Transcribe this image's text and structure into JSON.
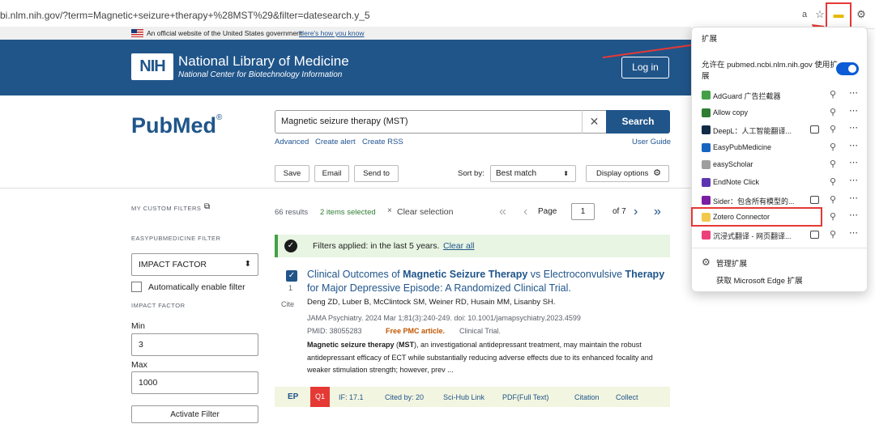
{
  "browser": {
    "url": "bi.nlm.nih.gov/?term=Magnetic+seizure+therapy+%28MST%29&filter=datesearch.y_5"
  },
  "gov_banner": {
    "text": "An official website of the United States government",
    "link": "Here's how you know"
  },
  "header": {
    "nih": "NIH",
    "title": "National Library of Medicine",
    "subtitle": "National Center for Biotechnology Information",
    "login": "Log in"
  },
  "logo": {
    "pub": "Pub",
    "med": "Med",
    "reg": "®"
  },
  "search": {
    "value": "Magnetic seizure therapy (MST)",
    "button": "Search",
    "advanced": "Advanced",
    "create_alert": "Create alert",
    "create_rss": "Create RSS",
    "user_guide": "User Guide"
  },
  "actions": {
    "save": "Save",
    "email": "Email",
    "send_to": "Send to",
    "sort_by": "Sort by:",
    "sort_value": "Best match",
    "display": "Display options"
  },
  "sidebar": {
    "custom_filters": "MY CUSTOM FILTERS",
    "easy_filter": "EASYPUBMEDICINE FILTER",
    "select": "IMPACT FACTOR",
    "auto": "Automatically enable filter",
    "if_label": "IMPACT FACTOR",
    "min_label": "Min",
    "min_value": "3",
    "max_label": "Max",
    "max_value": "1000",
    "activate": "Activate Filter"
  },
  "results": {
    "count": "66 results",
    "selected": "2 items selected",
    "clear": "Clear selection",
    "page_label": "Page",
    "page_value": "1",
    "page_of": "of 7",
    "filter_text": "Filters applied: in the last 5 years.",
    "filter_clear": "Clear all",
    "item": {
      "num": "1",
      "cite": "Cite",
      "title_a": "Clinical Outcomes of ",
      "title_b": "Magnetic Seizure Therapy",
      "title_c": " vs Electroconvulsive ",
      "title_d": "Therapy",
      "title_e": " for Major Depressive Episode: A Randomized Clinical Trial.",
      "authors": "Deng ZD, Luber B, McClintock SM, Weiner RD, Husain MM, Lisanby SH.",
      "journal": "JAMA Psychiatry. 2024 Mar 1;81(3):240-249. doi: 10.1001/jamapsychiatry.2023.4599",
      "pmid": "PMID: 38055283",
      "pmc": "Free PMC article.",
      "type": "Clinical Trial.",
      "snip_b": "Magnetic seizure therapy",
      "snip_mst": "MST",
      "snippet": "), an investigational antidepressant treatment, may maintain the robust antidepressant efficacy of ECT while substantially reducing adverse effects due to its enhanced focality and weaker stimulation strength; however, prev ..."
    },
    "easy_bar": {
      "logo": "EP",
      "q": "Q1",
      "if": "IF:  17.1",
      "cited": "Cited by:  20",
      "scihub": "Sci-Hub Link",
      "pdf": "PDF(Full Text)",
      "citation": "Citation",
      "collect": "Collect"
    }
  },
  "extensions": {
    "title": "扩展",
    "allow": "允许在 pubmed.ncbi.nlm.nih.gov 使用扩展",
    "items": [
      {
        "name": "AdGuard 广告拦截器",
        "icon": "adguard-icon",
        "color": "#43a047"
      },
      {
        "name": "Allow copy",
        "icon": "allow-copy-icon",
        "color": "#2e7d32"
      },
      {
        "name": "DeepL：人工智能翻译...",
        "icon": "deepl-icon",
        "color": "#0f2b46"
      },
      {
        "name": "EasyPubMedicine",
        "icon": "easypubmedicine-icon",
        "color": "#1565c0"
      },
      {
        "name": "easyScholar",
        "icon": "easyscholar-icon",
        "color": "#9e9e9e"
      },
      {
        "name": "EndNote Click",
        "icon": "endnote-icon",
        "color": "#5e35b1"
      },
      {
        "name": "Sider：包含所有模型的...",
        "icon": "sider-icon",
        "color": "#7b1fa2"
      },
      {
        "name": "Zotero Connector",
        "icon": "zotero-folder-icon",
        "color": "#f2c94c"
      },
      {
        "name": "沉浸式翻译 - 网页翻译...",
        "icon": "immersive-translate-icon",
        "color": "#ec407a"
      }
    ],
    "manage": "管理扩展",
    "get": "获取 Microsoft Edge 扩展"
  }
}
